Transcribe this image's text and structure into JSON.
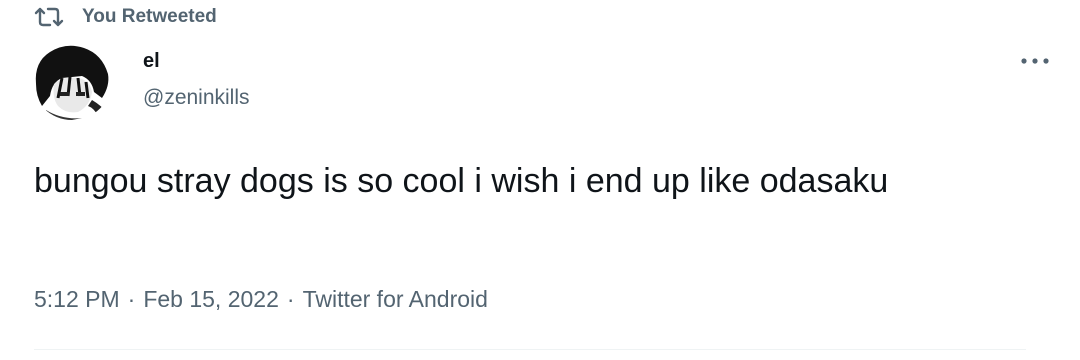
{
  "retweet": {
    "icon": "retweet-icon",
    "label": "You Retweeted"
  },
  "user": {
    "name": "el",
    "handle": "@zeninkills",
    "avatar_icon": "avatar-image"
  },
  "more": {
    "icon": "more-dots-icon",
    "label": "···"
  },
  "tweet": {
    "text": "bungou stray dogs is so cool i wish i end up like odasaku"
  },
  "meta": {
    "time": "5:12 PM",
    "sep1": "·",
    "date": "Feb 15, 2022",
    "sep2": "·",
    "source": "Twitter for Android"
  },
  "colors": {
    "text": "#0f1419",
    "secondary": "#536471",
    "divider": "#eff3f4"
  }
}
